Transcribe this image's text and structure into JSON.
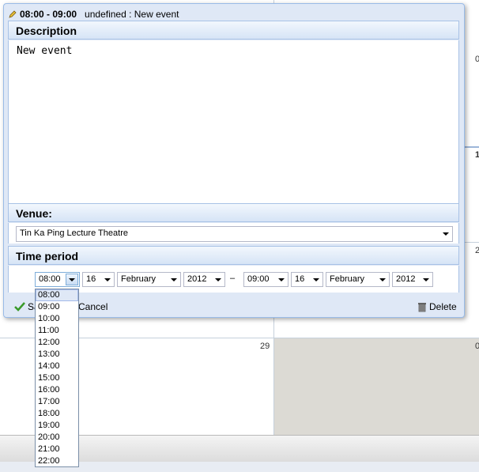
{
  "background": {
    "day_numbers": [
      "29",
      "0",
      "1",
      "2",
      "0"
    ]
  },
  "dialog": {
    "time_range": "08:00 - 09:00",
    "title_rest": "undefined : New event",
    "description": {
      "header": "Description",
      "text": "New event"
    },
    "venue": {
      "header": "Venue:",
      "value": "Tin Ka Ping Lecture Theatre"
    },
    "time_period": {
      "header": "Time period",
      "start_time": "08:00",
      "start_day": "16",
      "start_month": "February",
      "start_year": "2012",
      "separator": "–",
      "end_time": "09:00",
      "end_day": "16",
      "end_month": "February",
      "end_year": "2012"
    },
    "buttons": {
      "save_label": "Sa",
      "cancel_label": "Cancel",
      "delete_label": "Delete"
    }
  },
  "time_dropdown": {
    "options": [
      "08:00",
      "09:00",
      "10:00",
      "11:00",
      "12:00",
      "13:00",
      "14:00",
      "15:00",
      "16:00",
      "17:00",
      "18:00",
      "19:00",
      "20:00",
      "21:00",
      "22:00"
    ],
    "selected": "08:00"
  },
  "colors": {
    "dialog_bg": "#dfe8f6",
    "dialog_border": "#99bbe8",
    "header_gradient_end": "#d6e4f6",
    "selected_option_bg": "#dfe8f6"
  }
}
